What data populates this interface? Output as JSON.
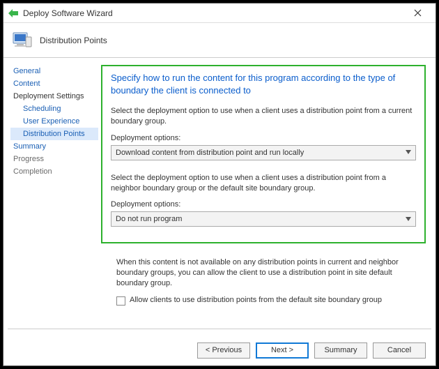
{
  "window": {
    "title": "Deploy Software Wizard",
    "page": "Distribution Points"
  },
  "sidebar": {
    "items": [
      {
        "label": "General",
        "level": 1,
        "style": "link"
      },
      {
        "label": "Content",
        "level": 1,
        "style": "link"
      },
      {
        "label": "Deployment Settings",
        "level": 1,
        "style": "dark"
      },
      {
        "label": "Scheduling",
        "level": 2,
        "style": "link"
      },
      {
        "label": "User Experience",
        "level": 2,
        "style": "link"
      },
      {
        "label": "Distribution Points",
        "level": 2,
        "style": "active"
      },
      {
        "label": "Summary",
        "level": 1,
        "style": "link"
      },
      {
        "label": "Progress",
        "level": 1,
        "style": "gray"
      },
      {
        "label": "Completion",
        "level": 1,
        "style": "gray"
      }
    ]
  },
  "main": {
    "heading": "Specify how to run the content for this program according to the type of boundary the client is connected to",
    "section1": {
      "description": "Select the deployment option to use when a client uses a distribution point from a current boundary group.",
      "label": "Deployment options:",
      "selected": "Download content from distribution point and run locally"
    },
    "section2": {
      "description": "Select the deployment option to use when a client uses a distribution point from a neighbor boundary group or the default site boundary group.",
      "label": "Deployment options:",
      "selected": "Do not run program"
    },
    "footer": {
      "description": "When this content is not available on any distribution points in current and neighbor boundary groups, you can allow the client to use a distribution point in site default boundary group.",
      "checkbox_label": "Allow clients to use distribution points from the default site boundary group",
      "checked": false
    }
  },
  "buttons": {
    "previous": "< Previous",
    "next": "Next >",
    "summary": "Summary",
    "cancel": "Cancel"
  }
}
